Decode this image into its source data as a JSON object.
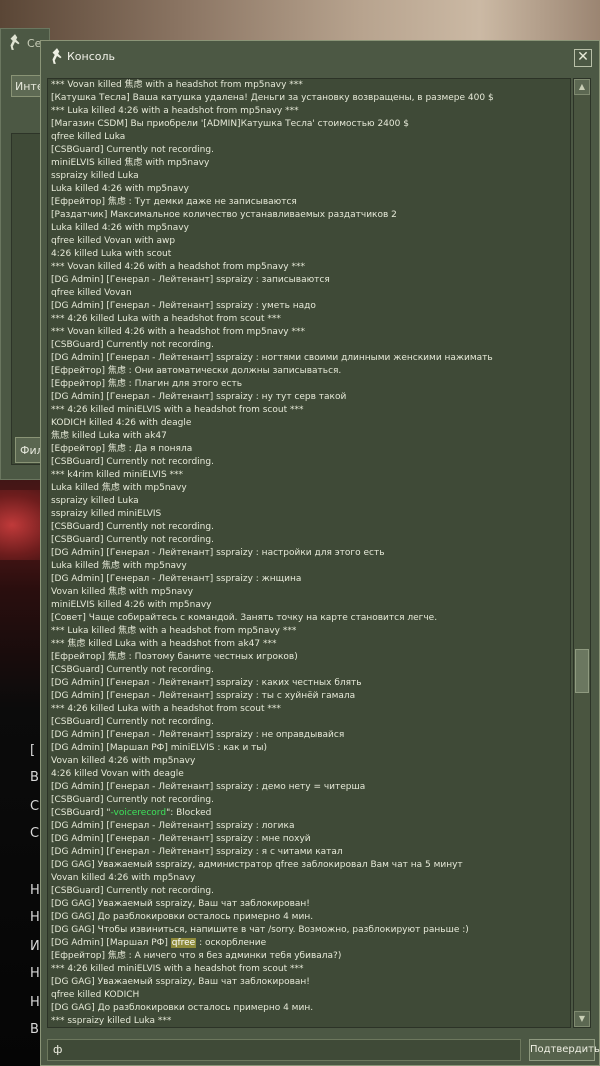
{
  "background": {
    "hud_glyphs": [
      "[",
      "В",
      "С",
      "С",
      "Н",
      "Н",
      "И",
      "Н",
      "Н",
      "В"
    ]
  },
  "servers_window": {
    "title": "Серверы",
    "tab": "Инте",
    "filter_button": "Фил"
  },
  "console": {
    "title": "Консоль",
    "close_glyph": "✕",
    "input_value": "ф",
    "submit_label": "Подтвердить",
    "scroll_up_glyph": "▲",
    "scroll_down_glyph": "▼",
    "lines": [
      "*** Vovan killed 焦虑 with a headshot from mp5navy ***",
      "[Катушка Тесла] Ваша катушка удалена! Деньги за установку возвращены, в размере 400 $",
      "*** Luka killed 4:26 with a headshot from mp5navy ***",
      "[Магазин CSDM] Вы приобрели '[ADMIN]Катушка Тесла' стоимостью 2400 $",
      "qfree killed Luka",
      "[CSBGuard] Currently not recording.",
      "miniELVIS killed 焦虑 with mp5navy",
      "sspraizy killed Luka",
      "Luka killed 4:26 with mp5navy",
      "[Ефрейтор] 焦虑 : Тут демки даже не записываются",
      "[Раздатчик] Максимальное количество устанавливаемых раздатчиков 2",
      "Luka killed 4:26 with mp5navy",
      "qfree killed Vovan with awp",
      "4:26 killed Luka with scout",
      "*** Vovan killed 4:26 with a headshot from mp5navy ***",
      "[DG Admin] [Генерал - Лейтенант] sspraizy : записываются",
      "qfree killed Vovan",
      "[DG Admin] [Генерал - Лейтенант] sspraizy : уметь надо",
      "*** 4:26 killed Luka with a headshot from scout ***",
      "*** Vovan killed 4:26 with a headshot from mp5navy ***",
      "[CSBGuard] Currently not recording.",
      "[DG Admin] [Генерал - Лейтенант] sspraizy : ногтями своими длинными женскими нажимать",
      "[Ефрейтор] 焦虑 : Они автоматически должны записываться.",
      "[Ефрейтор] 焦虑 : Плагин для этого есть",
      "[DG Admin] [Генерал - Лейтенант] sspraizy : ну тут серв такой",
      "*** 4:26 killed miniELVIS with a headshot from scout ***",
      "KODICH killed 4:26 with deagle",
      "焦虑 killed Luka with ak47",
      "[Ефрейтор] 焦虑 : Да я поняла",
      "[CSBGuard] Currently not recording.",
      "*** k4rim killed miniELVIS ***",
      "Luka killed 焦虑 with mp5navy",
      "sspraizy killed Luka",
      "sspraizy killed miniELVIS",
      "[CSBGuard] Currently not recording.",
      "[CSBGuard] Currently not recording.",
      "[DG Admin] [Генерал - Лейтенант] sspraizy : настройки для этого есть",
      "Luka killed 焦虑 with mp5navy",
      "[DG Admin] [Генерал - Лейтенант] sspraizy : жнщина",
      "Vovan killed 焦虑 with mp5navy",
      "miniELVIS killed 4:26 with mp5navy",
      "[Совет] Чаще собирайтесь с командой. Занять точку на карте становится легче.",
      "*** Luka killed 焦虑 with a headshot from mp5navy ***",
      "*** 焦虑 killed Luka with a headshot from ak47 ***",
      "[Ефрейтор] 焦虑 : Поэтому баните честных игроков)",
      "[CSBGuard] Currently not recording.",
      "[DG Admin] [Генерал - Лейтенант] sspraizy : каких честных блять",
      "[DG Admin] [Генерал - Лейтенант] sspraizy : ты с хуйнёй гамала",
      "*** 4:26 killed Luka with a headshot from scout ***",
      "[CSBGuard] Currently not recording.",
      "[DG Admin] [Генерал - Лейтенант] sspraizy : не оправдывайся",
      "[DG Admin] [Маршал РФ] miniELVIS : как и ты)",
      "Vovan killed 4:26 with mp5navy",
      "4:26 killed Vovan with deagle",
      "[DG Admin] [Генерал - Лейтенант] sspraizy : демо нету = читерша",
      "[CSBGuard] Currently not recording.",
      "[CSBGuard] \"-voicerecord\": Blocked",
      "[DG Admin] [Генерал - Лейтенант] sspraizy : логика",
      "[DG Admin] [Генерал - Лейтенант] sspraizy : мне похуй",
      "[DG Admin] [Генерал - Лейтенант] sspraizy : я с читами катал",
      "[DG GAG] Уважаемый sspraizy, администратор qfree заблокировал Вам чат на 5 минут",
      "Vovan killed 4:26 with mp5navy",
      "[CSBGuard] Currently not recording.",
      "[DG GAG] Уважаемый sspraizy, Ваш чат заблокирован!",
      "[DG GAG] До разблокировки осталось примерно 4 мин.",
      "[DG GAG] Чтобы извиниться, напишите в чат /sorry. Возможно, разблокируют раньше :)",
      "[DG Admin] [Маршал РФ] qfree : оскорбление",
      "[Ефрейтор] 焦虑 : А ничего что я без админки тебя убивала?)",
      "*** 4:26 killed miniELVIS with a headshot from scout ***",
      "[DG GAG] Уважаемый sspraizy, Ваш чат заблокирован!",
      "qfree killed KODICH",
      "[DG GAG] До разблокировки осталось примерно 4 мин.",
      "*** sspraizy killed Luka ***",
      "[DG GAG] Чтобы извиниться, напишите в чат /sorry. Возможно, разблокируют раньше :)"
    ]
  }
}
